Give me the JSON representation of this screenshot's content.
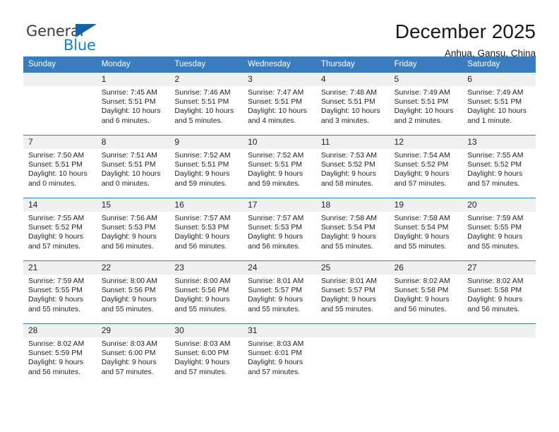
{
  "brand": {
    "name_top": "General",
    "name_bottom": "Blue",
    "triangle_color": "#1464a5",
    "blue_color": "#1c7fc4"
  },
  "header": {
    "title": "December 2025",
    "subtitle": "Anhua, Gansu, China"
  },
  "theme": {
    "header_bg": "#3a7dbf",
    "daynum_bg": "#f0f0f0",
    "text": "#231f20"
  },
  "weekday_headers": [
    "Sunday",
    "Monday",
    "Tuesday",
    "Wednesday",
    "Thursday",
    "Friday",
    "Saturday"
  ],
  "weeks": [
    [
      {
        "day": "",
        "sunrise": "",
        "sunset": "",
        "daylight": ""
      },
      {
        "day": "1",
        "sunrise": "Sunrise: 7:45 AM",
        "sunset": "Sunset: 5:51 PM",
        "daylight": "Daylight: 10 hours and 6 minutes."
      },
      {
        "day": "2",
        "sunrise": "Sunrise: 7:46 AM",
        "sunset": "Sunset: 5:51 PM",
        "daylight": "Daylight: 10 hours and 5 minutes."
      },
      {
        "day": "3",
        "sunrise": "Sunrise: 7:47 AM",
        "sunset": "Sunset: 5:51 PM",
        "daylight": "Daylight: 10 hours and 4 minutes."
      },
      {
        "day": "4",
        "sunrise": "Sunrise: 7:48 AM",
        "sunset": "Sunset: 5:51 PM",
        "daylight": "Daylight: 10 hours and 3 minutes."
      },
      {
        "day": "5",
        "sunrise": "Sunrise: 7:49 AM",
        "sunset": "Sunset: 5:51 PM",
        "daylight": "Daylight: 10 hours and 2 minutes."
      },
      {
        "day": "6",
        "sunrise": "Sunrise: 7:49 AM",
        "sunset": "Sunset: 5:51 PM",
        "daylight": "Daylight: 10 hours and 1 minute."
      }
    ],
    [
      {
        "day": "7",
        "sunrise": "Sunrise: 7:50 AM",
        "sunset": "Sunset: 5:51 PM",
        "daylight": "Daylight: 10 hours and 0 minutes."
      },
      {
        "day": "8",
        "sunrise": "Sunrise: 7:51 AM",
        "sunset": "Sunset: 5:51 PM",
        "daylight": "Daylight: 10 hours and 0 minutes."
      },
      {
        "day": "9",
        "sunrise": "Sunrise: 7:52 AM",
        "sunset": "Sunset: 5:51 PM",
        "daylight": "Daylight: 9 hours and 59 minutes."
      },
      {
        "day": "10",
        "sunrise": "Sunrise: 7:52 AM",
        "sunset": "Sunset: 5:51 PM",
        "daylight": "Daylight: 9 hours and 59 minutes."
      },
      {
        "day": "11",
        "sunrise": "Sunrise: 7:53 AM",
        "sunset": "Sunset: 5:52 PM",
        "daylight": "Daylight: 9 hours and 58 minutes."
      },
      {
        "day": "12",
        "sunrise": "Sunrise: 7:54 AM",
        "sunset": "Sunset: 5:52 PM",
        "daylight": "Daylight: 9 hours and 57 minutes."
      },
      {
        "day": "13",
        "sunrise": "Sunrise: 7:55 AM",
        "sunset": "Sunset: 5:52 PM",
        "daylight": "Daylight: 9 hours and 57 minutes."
      }
    ],
    [
      {
        "day": "14",
        "sunrise": "Sunrise: 7:55 AM",
        "sunset": "Sunset: 5:52 PM",
        "daylight": "Daylight: 9 hours and 57 minutes."
      },
      {
        "day": "15",
        "sunrise": "Sunrise: 7:56 AM",
        "sunset": "Sunset: 5:53 PM",
        "daylight": "Daylight: 9 hours and 56 minutes."
      },
      {
        "day": "16",
        "sunrise": "Sunrise: 7:57 AM",
        "sunset": "Sunset: 5:53 PM",
        "daylight": "Daylight: 9 hours and 56 minutes."
      },
      {
        "day": "17",
        "sunrise": "Sunrise: 7:57 AM",
        "sunset": "Sunset: 5:53 PM",
        "daylight": "Daylight: 9 hours and 56 minutes."
      },
      {
        "day": "18",
        "sunrise": "Sunrise: 7:58 AM",
        "sunset": "Sunset: 5:54 PM",
        "daylight": "Daylight: 9 hours and 55 minutes."
      },
      {
        "day": "19",
        "sunrise": "Sunrise: 7:58 AM",
        "sunset": "Sunset: 5:54 PM",
        "daylight": "Daylight: 9 hours and 55 minutes."
      },
      {
        "day": "20",
        "sunrise": "Sunrise: 7:59 AM",
        "sunset": "Sunset: 5:55 PM",
        "daylight": "Daylight: 9 hours and 55 minutes."
      }
    ],
    [
      {
        "day": "21",
        "sunrise": "Sunrise: 7:59 AM",
        "sunset": "Sunset: 5:55 PM",
        "daylight": "Daylight: 9 hours and 55 minutes."
      },
      {
        "day": "22",
        "sunrise": "Sunrise: 8:00 AM",
        "sunset": "Sunset: 5:56 PM",
        "daylight": "Daylight: 9 hours and 55 minutes."
      },
      {
        "day": "23",
        "sunrise": "Sunrise: 8:00 AM",
        "sunset": "Sunset: 5:56 PM",
        "daylight": "Daylight: 9 hours and 55 minutes."
      },
      {
        "day": "24",
        "sunrise": "Sunrise: 8:01 AM",
        "sunset": "Sunset: 5:57 PM",
        "daylight": "Daylight: 9 hours and 55 minutes."
      },
      {
        "day": "25",
        "sunrise": "Sunrise: 8:01 AM",
        "sunset": "Sunset: 5:57 PM",
        "daylight": "Daylight: 9 hours and 55 minutes."
      },
      {
        "day": "26",
        "sunrise": "Sunrise: 8:02 AM",
        "sunset": "Sunset: 5:58 PM",
        "daylight": "Daylight: 9 hours and 56 minutes."
      },
      {
        "day": "27",
        "sunrise": "Sunrise: 8:02 AM",
        "sunset": "Sunset: 5:58 PM",
        "daylight": "Daylight: 9 hours and 56 minutes."
      }
    ],
    [
      {
        "day": "28",
        "sunrise": "Sunrise: 8:02 AM",
        "sunset": "Sunset: 5:59 PM",
        "daylight": "Daylight: 9 hours and 56 minutes."
      },
      {
        "day": "29",
        "sunrise": "Sunrise: 8:03 AM",
        "sunset": "Sunset: 6:00 PM",
        "daylight": "Daylight: 9 hours and 57 minutes."
      },
      {
        "day": "30",
        "sunrise": "Sunrise: 8:03 AM",
        "sunset": "Sunset: 6:00 PM",
        "daylight": "Daylight: 9 hours and 57 minutes."
      },
      {
        "day": "31",
        "sunrise": "Sunrise: 8:03 AM",
        "sunset": "Sunset: 6:01 PM",
        "daylight": "Daylight: 9 hours and 57 minutes."
      },
      {
        "day": "",
        "sunrise": "",
        "sunset": "",
        "daylight": ""
      },
      {
        "day": "",
        "sunrise": "",
        "sunset": "",
        "daylight": ""
      },
      {
        "day": "",
        "sunrise": "",
        "sunset": "",
        "daylight": ""
      }
    ]
  ]
}
